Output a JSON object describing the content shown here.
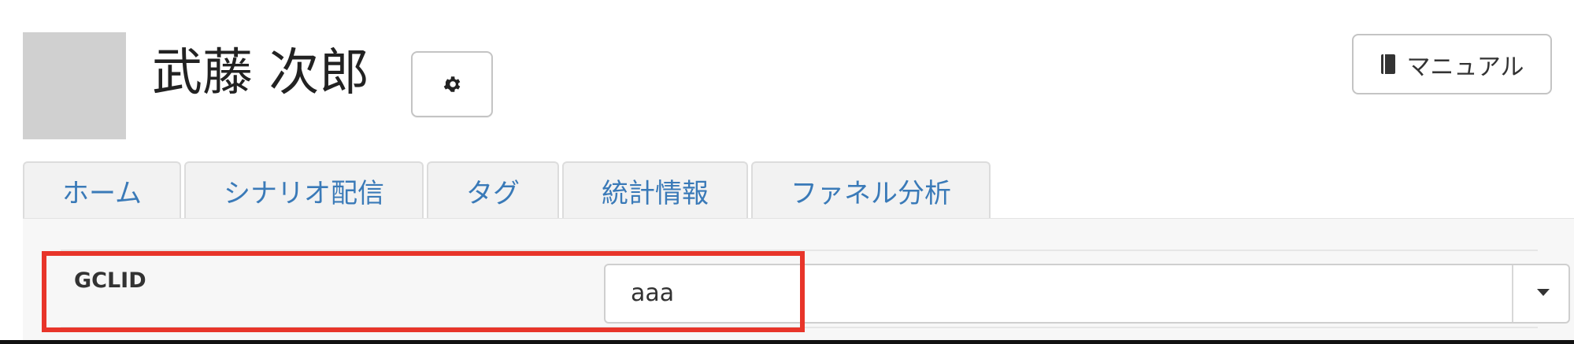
{
  "header": {
    "user_name": "武藤 次郎",
    "settings_icon": "gear-icon",
    "manual_label": "マニュアル",
    "manual_icon": "book-icon"
  },
  "tabs": [
    {
      "label": "ホーム"
    },
    {
      "label": "シナリオ配信"
    },
    {
      "label": "タグ"
    },
    {
      "label": "統計情報"
    },
    {
      "label": "ファネル分析"
    }
  ],
  "form": {
    "field_label": "GCLID",
    "select_value": "aaa"
  },
  "colors": {
    "tab_text": "#3a7ab8",
    "highlight": "#e8352a"
  }
}
